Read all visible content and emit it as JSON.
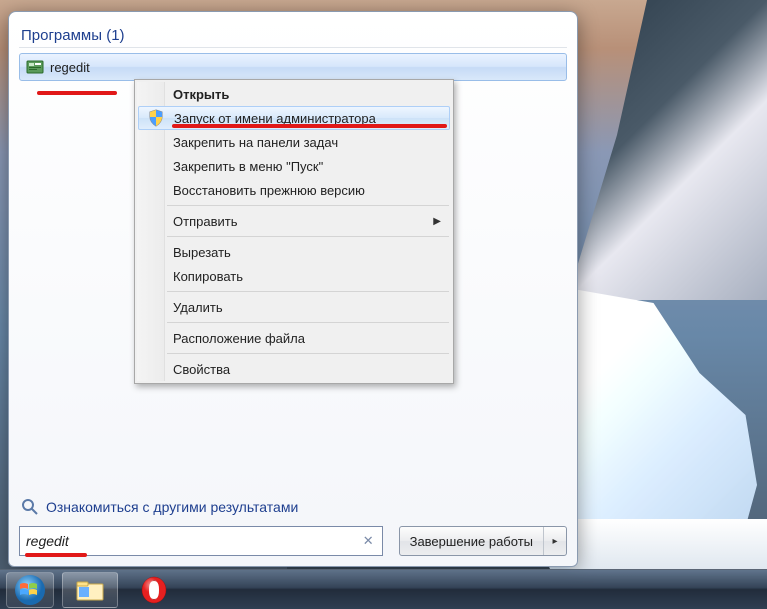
{
  "programs_header": "Программы (1)",
  "result": {
    "label": "regedit"
  },
  "context_menu": {
    "open": "Открыть",
    "run_as_admin": "Запуск от имени администратора",
    "pin_taskbar": "Закрепить на панели задач",
    "pin_start": "Закрепить в меню \"Пуск\"",
    "restore_prev": "Восстановить прежнюю версию",
    "send_to": "Отправить",
    "cut": "Вырезать",
    "copy": "Копировать",
    "delete": "Удалить",
    "file_location": "Расположение файла",
    "properties": "Свойства"
  },
  "other_results": "Ознакомиться с другими результатами",
  "search": {
    "value": "regedit"
  },
  "shutdown": {
    "label": "Завершение работы"
  }
}
